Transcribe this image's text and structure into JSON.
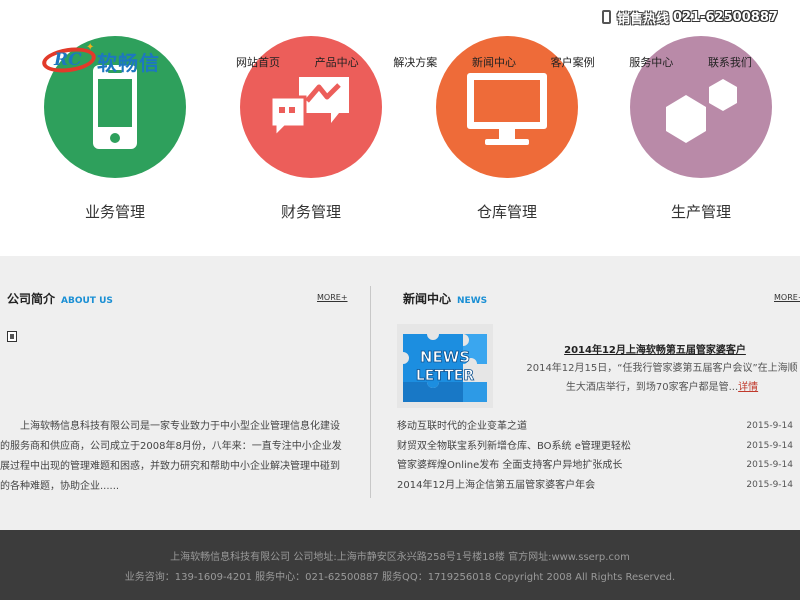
{
  "header": {
    "hotline_label": "销售热线",
    "hotline_number": "021-62500887",
    "logo_badge": "RC",
    "logo_text": "软畅信"
  },
  "nav": {
    "items": [
      {
        "label": "网站首页"
      },
      {
        "label": "产品中心"
      },
      {
        "label": "解决方案"
      },
      {
        "label": "新闻中心"
      },
      {
        "label": "客户案例"
      },
      {
        "label": "服务中心"
      },
      {
        "label": "联系我们"
      }
    ]
  },
  "features": [
    {
      "caption": "业务管理",
      "icon": "mobile-phone-icon",
      "color": "#2ea05c"
    },
    {
      "caption": "财务管理",
      "icon": "chat-bubbles-icon",
      "color": "#ec5e5a"
    },
    {
      "caption": "仓库管理",
      "icon": "monitor-icon",
      "color": "#ee6b39"
    },
    {
      "caption": "生产管理",
      "icon": "hexagons-icon",
      "color": "#b98aa8"
    }
  ],
  "about": {
    "title": "公司简介",
    "title_en": "ABOUT US",
    "more": "MORE+",
    "text": "上海软畅信息科技有限公司是一家专业致力于中小型企业管理信息化建设的服务商和供应商，公司成立于2008年8月份，八年来：一直专注中小企业发展过程中出现的管理难题和困惑，并致力研究和帮助中小企业解决管理中碰到的各种难题，协助企业......"
  },
  "news": {
    "title": "新闻中心",
    "title_en": "NEWS",
    "more": "MORE+",
    "image_text_line1": "NEWS",
    "image_text_line2": "LETTER",
    "featured_title": "2014年12月上海软畅第五届管家婆客户",
    "featured_desc": "2014年12月15日，“任我行管家婆第五届客户会议”在上海顺生大酒店举行，到场70家客户都是管...",
    "detail_link": "详情",
    "items": [
      {
        "title": "移动互联时代的企业变革之道",
        "date": "2015-9-14"
      },
      {
        "title": "财贸双全物联宝系列新增仓库、BO系统 e管理更轻松",
        "date": "2015-9-14"
      },
      {
        "title": "管家婆辉煌Online发布 全面支持客户异地扩张成长",
        "date": "2015-9-14"
      },
      {
        "title": "2014年12月上海企信第五届管家婆客户年会",
        "date": "2015-9-14"
      }
    ]
  },
  "footer": {
    "line1": "上海软畅信息科技有限公司 公司地址:上海市静安区永兴路258号1号楼18楼 官方网址:www.sserp.com",
    "line2": "业务咨询：139-1609-4201 服务中心：021-62500887 服务QQ：1719256018 Copyright 2008 All Rights Reserved."
  },
  "colors": {
    "accent_blue": "#1a8fd4",
    "footer_bg": "#3c3c3c",
    "band_bg": "#efefef",
    "detail_link": "#c0392b"
  }
}
